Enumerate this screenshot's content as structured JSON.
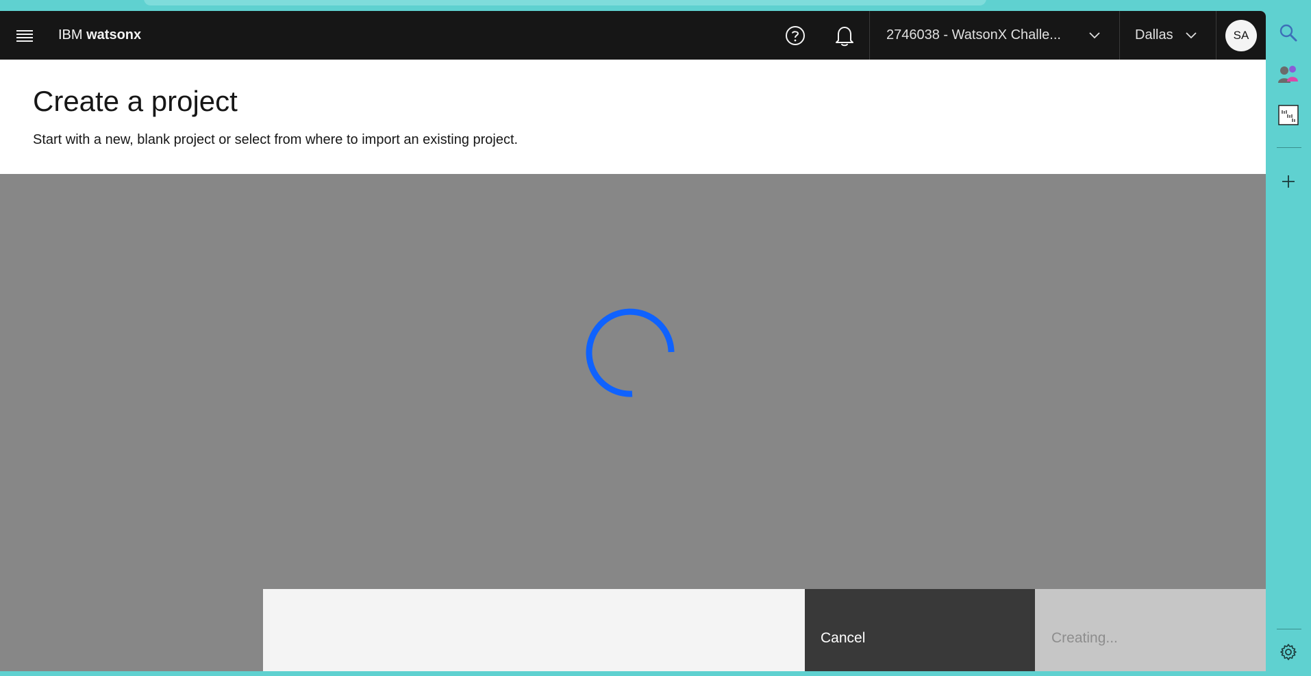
{
  "header": {
    "brand_prefix": "IBM",
    "brand_name": "watsonx",
    "account": "2746038 - WatsonX Challe...",
    "region": "Dallas",
    "avatar_initials": "SA"
  },
  "page": {
    "title": "Create a project",
    "subtitle": "Start with a new, blank project or select from where to import an existing project."
  },
  "footer": {
    "cancel_label": "Cancel",
    "creating_label": "Creating..."
  },
  "icons": {
    "menu": "hamburger-menu-icon",
    "help": "help-icon",
    "notification": "notification-bell-icon",
    "chevron": "chevron-down-icon",
    "spinner": "loading-spinner-icon",
    "rail": [
      "search-icon",
      "people-icon",
      "lab-ai-icon",
      "add-icon",
      "settings-icon"
    ]
  },
  "colors": {
    "header_bg": "#161616",
    "overlay": "#878787",
    "spinner": "#0f62fe",
    "secondary_button": "#393939",
    "disabled_button": "#c6c6c6",
    "rail_bg": "#5fd1d0"
  }
}
